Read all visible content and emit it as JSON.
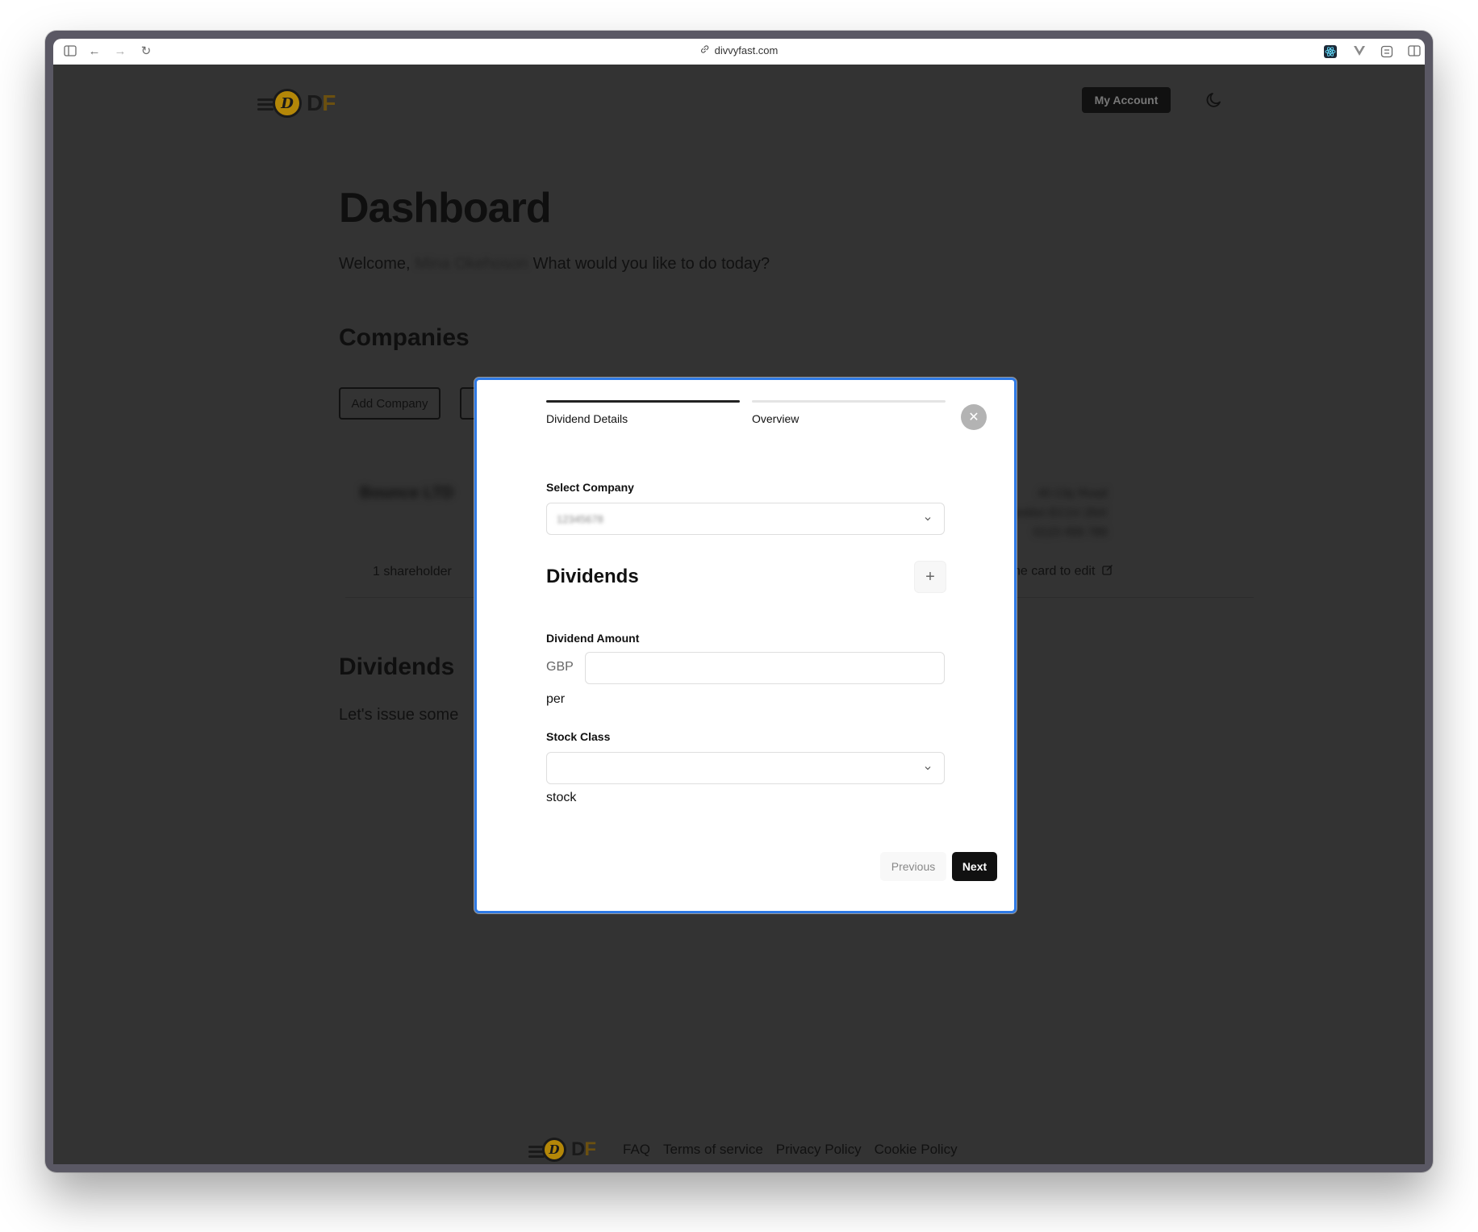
{
  "browser": {
    "url": "divvyfast.com"
  },
  "header": {
    "logo_letters_d": "D",
    "logo_letters_f": "F",
    "coin_letter": "D",
    "my_account_label": "My Account"
  },
  "dashboard": {
    "title": "Dashboard",
    "welcome_prefix": "Welcome,",
    "welcome_name_redacted": "Mina Okehoson",
    "welcome_suffix": "What would you like to do today?"
  },
  "companies": {
    "title": "Companies",
    "add_company_label": "Add Company",
    "card": {
      "name_redacted": "Bounce LTD",
      "shareholders": "1 shareholder",
      "address_redacted": [
        "45 City Road",
        "London EC1V 2NX",
        "0123 456 789"
      ],
      "edit_hint": "he card to edit"
    }
  },
  "dividends_section": {
    "title": "Dividends",
    "text": "Let's issue some"
  },
  "footer": {
    "links": [
      "FAQ",
      "Terms of service",
      "Privacy Policy",
      "Cookie Policy"
    ]
  },
  "modal": {
    "steps": [
      "Dividend Details",
      "Overview"
    ],
    "active_step": 0,
    "select_company_label": "Select Company",
    "select_company_value_redacted": "12345678",
    "dividends_title": "Dividends",
    "dividend_amount_label": "Dividend Amount",
    "currency": "GBP",
    "amount_value": "",
    "per_text": "per",
    "stock_class_label": "Stock Class",
    "stock_class_value": "",
    "stock_text": "stock",
    "previous_label": "Previous",
    "next_label": "Next"
  },
  "colors": {
    "modal_border": "#2f7ae5",
    "backdrop": "#333333",
    "primary_button": "#111111",
    "coin_gold": "#b48708"
  }
}
